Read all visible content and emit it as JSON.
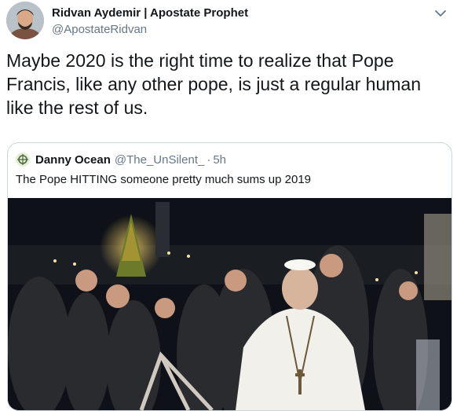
{
  "author": {
    "display_name": "Ridvan Aydemir | Apostate Prophet",
    "handle": "@ApostateRidvan"
  },
  "tweet": {
    "text": "Maybe 2020 is the right time to realize that Pope Francis, like any other pope, is just a regular human like the rest of us."
  },
  "quoted_tweet": {
    "display_name": "Danny Ocean",
    "handle": "@The_UnSilent_",
    "separator": "·",
    "time": "5h",
    "text": "The Pope HITTING someone pretty much sums up 2019"
  },
  "icons": {
    "menu": "chevron-down-icon",
    "author_avatar": "avatar",
    "quoted_avatar": "avatar",
    "media": "video-thumbnail"
  },
  "colors": {
    "primary_text": "#14171a",
    "secondary_text": "#657786",
    "border": "#ccd6dd"
  }
}
